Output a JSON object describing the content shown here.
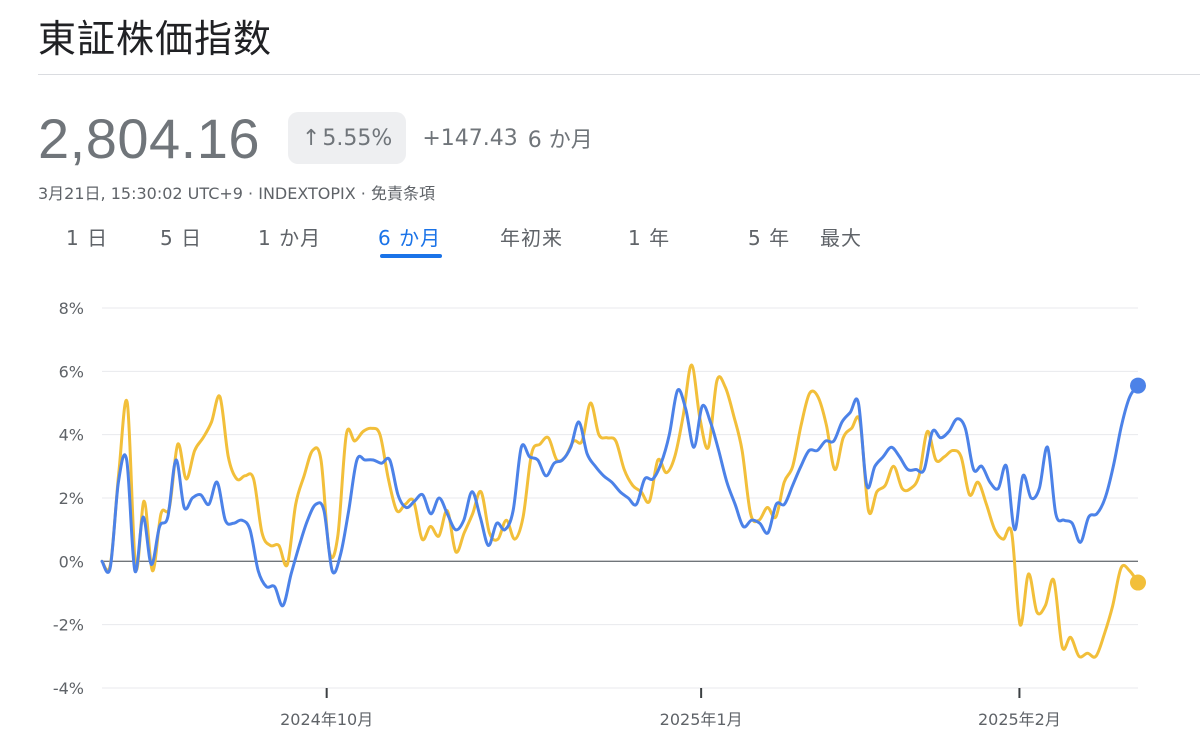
{
  "header": {
    "title": "東証株価指数"
  },
  "quote": {
    "price": "2,804.16",
    "change_arrow": "↑",
    "change_pct": "5.55%",
    "change_abs": "+147.43",
    "period": "6 か月",
    "meta": "3月21日, 15:30:02 UTC+9 · INDEXTOPIX · 免責条項"
  },
  "tabs": [
    {
      "label": "1 日",
      "active": false
    },
    {
      "label": "5 日",
      "active": false
    },
    {
      "label": "1 か月",
      "active": false
    },
    {
      "label": "6 か月",
      "active": true
    },
    {
      "label": "年初来",
      "active": false
    },
    {
      "label": "1 年",
      "active": false
    },
    {
      "label": "5 年",
      "active": false
    },
    {
      "label": "最大",
      "active": false
    }
  ],
  "colors": {
    "accent": "#1a73e8",
    "blue_series": "#4c82e8",
    "yellow_series": "#f2bf3a",
    "muted_text": "#70757a"
  },
  "chart_data": {
    "type": "line",
    "ylim": [
      -4,
      8
    ],
    "y_ticks": [
      -4,
      -2,
      0,
      2,
      4,
      6,
      8
    ],
    "y_tick_labels": [
      "-4%",
      "-2%",
      "0%",
      "2%",
      "4%",
      "6%",
      "8%"
    ],
    "x_tick_labels": [
      {
        "label": "2024年10月",
        "x": 36
      },
      {
        "label": "2025年1月",
        "x": 96
      },
      {
        "label": "2025年2月",
        "x": 147
      }
    ],
    "x_range": [
      0,
      166
    ],
    "grid": true,
    "series": [
      {
        "color": "#4c82e8",
        "values": [
          0,
          -0.2,
          2.5,
          3.2,
          -0.3,
          1.4,
          -0.1,
          1.1,
          1.4,
          3.2,
          1.7,
          2.0,
          2.1,
          1.8,
          2.5,
          1.3,
          1.2,
          1.3,
          1.0,
          -0.3,
          -0.8,
          -0.8,
          -1.4,
          -0.4,
          0.5,
          1.3,
          1.8,
          1.6,
          -0.3,
          0.2,
          1.6,
          3.2,
          3.2,
          3.2,
          3.1,
          3.2,
          2.1,
          1.7,
          1.9,
          2.1,
          1.5,
          2.0,
          1.5,
          1.0,
          1.3,
          2.2,
          1.4,
          0.5,
          1.2,
          1.0,
          1.6,
          3.6,
          3.3,
          3.2,
          2.7,
          3.1,
          3.2,
          3.6,
          4.4,
          3.4,
          3.0,
          2.7,
          2.5,
          2.2,
          2.0,
          1.8,
          2.6,
          2.6,
          3.1,
          4.0,
          5.4,
          4.8,
          3.6,
          4.9,
          4.4,
          3.5,
          2.5,
          1.8,
          1.1,
          1.3,
          1.2,
          0.9,
          1.8,
          1.8,
          2.4,
          3.0,
          3.5,
          3.5,
          3.8,
          3.8,
          4.4,
          4.7,
          5.0,
          2.4,
          3.0,
          3.3,
          3.6,
          3.3,
          2.9,
          2.9,
          2.9,
          4.1,
          3.9,
          4.1,
          4.5,
          4.2,
          2.9,
          3.0,
          2.5,
          2.3,
          3.0,
          1.0,
          2.7,
          2.0,
          2.3,
          3.6,
          1.5,
          1.3,
          1.2,
          0.6,
          1.4,
          1.5,
          2.0,
          3.0,
          4.3,
          5.2,
          5.55
        ]
      },
      {
        "color": "#f2bf3a",
        "values": [
          0,
          -0.1,
          2.8,
          5.0,
          -0.2,
          1.9,
          -0.3,
          1.5,
          1.7,
          3.7,
          2.6,
          3.5,
          3.9,
          4.4,
          5.2,
          3.3,
          2.6,
          2.7,
          2.6,
          0.9,
          0.5,
          0.5,
          -0.1,
          1.8,
          2.7,
          3.5,
          3.2,
          0.3,
          0.8,
          4.0,
          3.8,
          4.1,
          4.2,
          4.0,
          2.6,
          1.6,
          1.8,
          1.9,
          0.7,
          1.1,
          0.8,
          1.6,
          0.3,
          0.9,
          1.5,
          2.2,
          0.9,
          0.7,
          1.3,
          0.7,
          1.4,
          3.4,
          3.7,
          3.9,
          3.2,
          3.3,
          3.8,
          3.8,
          5.0,
          4.0,
          3.9,
          3.8,
          2.9,
          2.4,
          2.2,
          1.9,
          3.2,
          2.8,
          3.3,
          4.6,
          6.2,
          4.5,
          3.6,
          5.7,
          5.5,
          4.6,
          3.5,
          1.5,
          1.3,
          1.7,
          1.4,
          2.5,
          3.0,
          4.3,
          5.3,
          5.2,
          4.3,
          2.9,
          3.9,
          4.2,
          4.4,
          1.6,
          2.2,
          2.4,
          3.0,
          2.3,
          2.3,
          2.7,
          4.1,
          3.2,
          3.3,
          3.5,
          3.3,
          2.1,
          2.5,
          1.8,
          1.0,
          0.7,
          0.9,
          -2.0,
          -0.4,
          -1.6,
          -1.4,
          -0.6,
          -2.7,
          -2.4,
          -3.0,
          -2.9,
          -3.0,
          -2.3,
          -1.4,
          -0.2,
          -0.3,
          -0.67
        ]
      }
    ]
  }
}
